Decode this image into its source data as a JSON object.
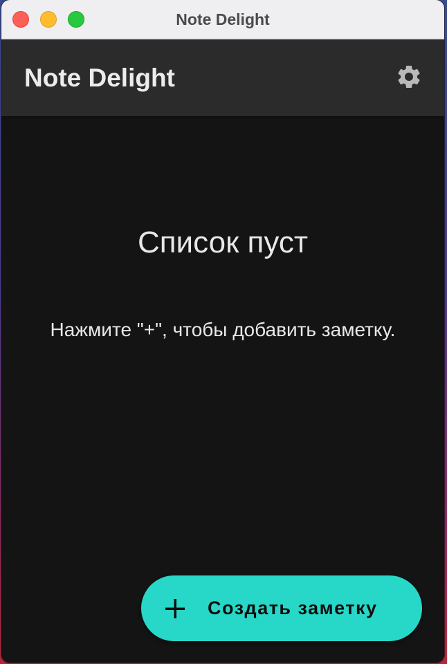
{
  "window": {
    "title": "Note Delight"
  },
  "appbar": {
    "title": "Note Delight",
    "settings_icon": "gear-icon"
  },
  "empty_state": {
    "title": "Список пуст",
    "hint": "Нажмите \"+\", чтобы добавить заметку."
  },
  "fab": {
    "icon": "plus-icon",
    "label": "Создать заметку"
  },
  "colors": {
    "accent": "#27d8c8",
    "appbar": "#2b2b2b",
    "background": "#141414"
  }
}
